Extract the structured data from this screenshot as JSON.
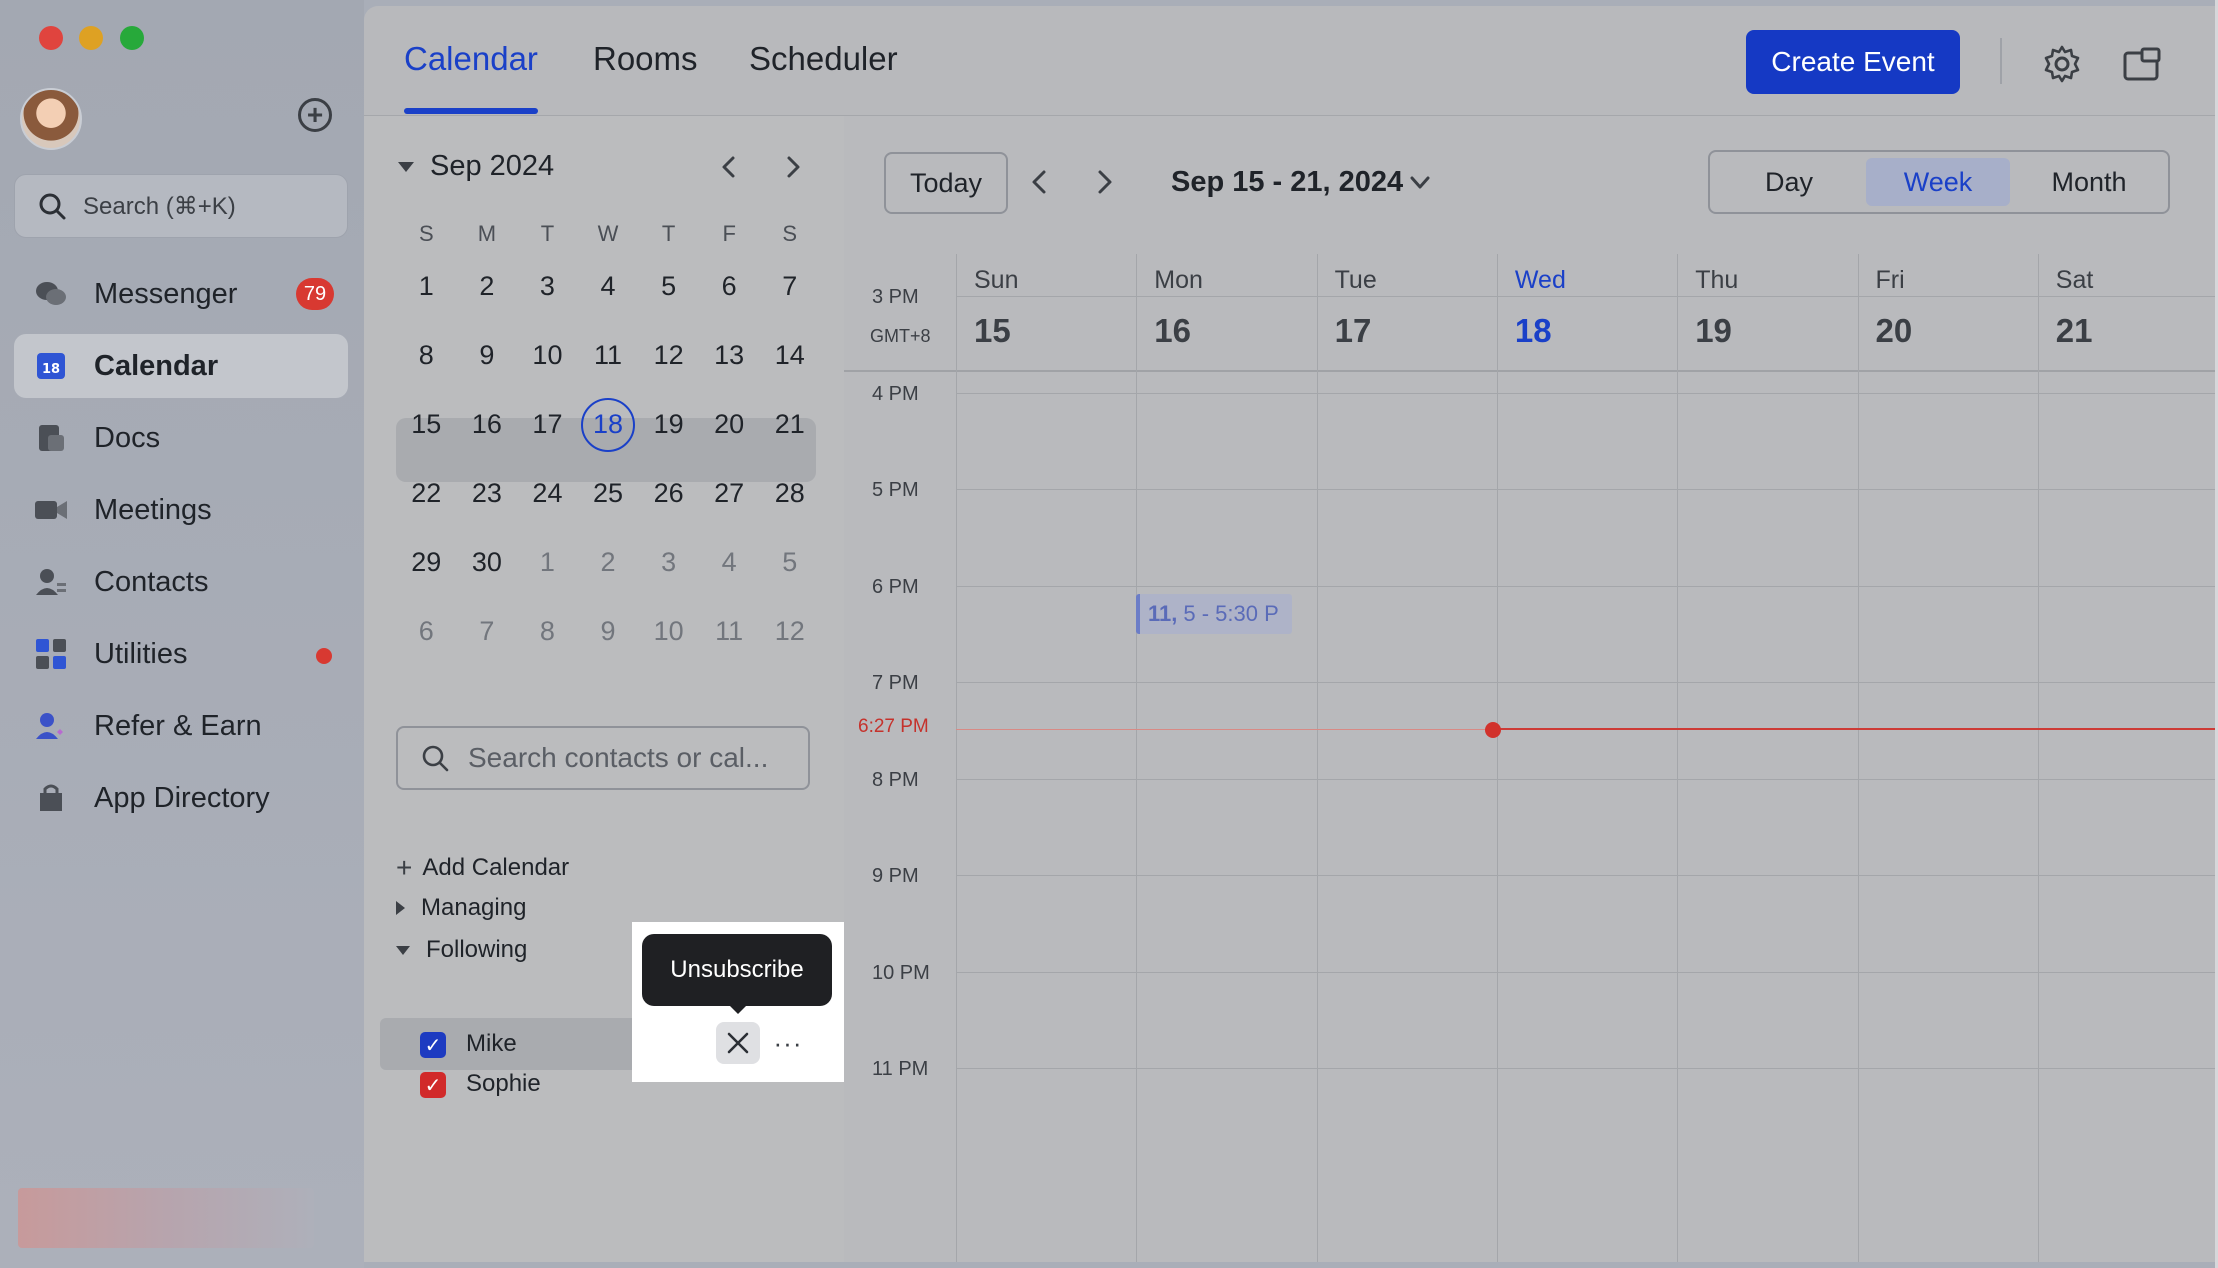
{
  "sidebar": {
    "search_placeholder": "Search (⌘+K)",
    "items": [
      {
        "label": "Messenger",
        "badge": "79",
        "icon": "chat-bubbles-icon"
      },
      {
        "label": "Calendar",
        "icon": "calendar-icon",
        "icon_text": "18",
        "active": true
      },
      {
        "label": "Docs",
        "icon": "docs-icon"
      },
      {
        "label": "Meetings",
        "icon": "video-camera-icon"
      },
      {
        "label": "Contacts",
        "icon": "contacts-icon"
      },
      {
        "label": "Utilities",
        "icon": "utilities-icon",
        "dot": true
      },
      {
        "label": "Refer & Earn",
        "icon": "refer-icon"
      },
      {
        "label": "App Directory",
        "icon": "app-directory-icon"
      }
    ]
  },
  "header": {
    "tabs": [
      "Calendar",
      "Rooms",
      "Scheduler"
    ],
    "create_label": "Create Event"
  },
  "minical": {
    "title": "Sep 2024",
    "weekdays": [
      "S",
      "M",
      "T",
      "W",
      "T",
      "F",
      "S"
    ],
    "weeks": [
      [
        "1",
        "2",
        "3",
        "4",
        "5",
        "6",
        "7"
      ],
      [
        "8",
        "9",
        "10",
        "11",
        "12",
        "13",
        "14"
      ],
      [
        "15",
        "16",
        "17",
        "18",
        "19",
        "20",
        "21"
      ],
      [
        "22",
        "23",
        "24",
        "25",
        "26",
        "27",
        "28"
      ],
      [
        "29",
        "30",
        "1",
        "2",
        "3",
        "4",
        "5"
      ],
      [
        "6",
        "7",
        "8",
        "9",
        "10",
        "11",
        "12"
      ]
    ],
    "search_placeholder": "Search contacts or cal...",
    "add_calendar": "Add Calendar",
    "managing": "Managing",
    "following": "Following",
    "subscriptions": [
      {
        "name": "Mike",
        "color": "#1d3bc1"
      },
      {
        "name": "Sophie",
        "color": "#d12a2a"
      }
    ],
    "tooltip": "Unsubscribe",
    "more": "···"
  },
  "week": {
    "today_label": "Today",
    "range": "Sep 15 - 21, 2024",
    "views": [
      "Day",
      "Week",
      "Month"
    ],
    "active_view": "Week",
    "timezone": "GMT+8",
    "days": [
      {
        "name": "Sun",
        "num": "15"
      },
      {
        "name": "Mon",
        "num": "16"
      },
      {
        "name": "Tue",
        "num": "17"
      },
      {
        "name": "Wed",
        "num": "18",
        "today": true
      },
      {
        "name": "Thu",
        "num": "19"
      },
      {
        "name": "Fri",
        "num": "20"
      },
      {
        "name": "Sat",
        "num": "21"
      }
    ],
    "hours": [
      "3 PM",
      "4 PM",
      "5 PM",
      "6 PM",
      "7 PM",
      "8 PM",
      "9 PM",
      "10 PM",
      "11 PM"
    ],
    "now_label": "6:27 PM",
    "event": {
      "title": "11,",
      "time": "5 - 5:30 P"
    }
  },
  "colors": {
    "accent": "#1a40c8",
    "now": "#d1322c",
    "badge": "#d83931"
  }
}
